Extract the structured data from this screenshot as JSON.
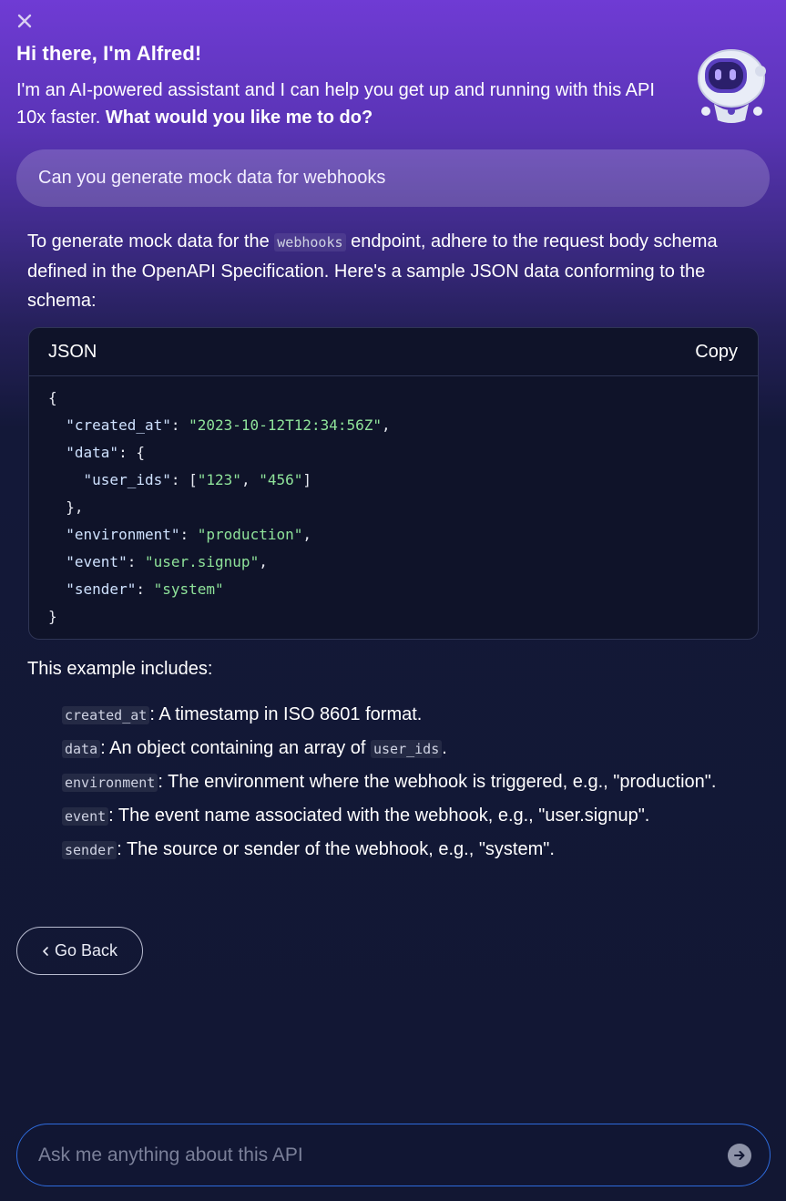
{
  "header": {
    "title": "Hi there, I'm Alfred!",
    "intro_plain": "I'm an AI-powered assistant and I can help you get up and running with this API 10x faster. ",
    "intro_bold": "What would you like me to do?"
  },
  "user_message": "Can you generate mock data for webhooks",
  "answer": {
    "intro_prefix": "To generate mock data for the ",
    "intro_code": "webhooks",
    "intro_suffix": " endpoint, adhere to the request body schema defined in the OpenAPI Specification. Here's a sample JSON data conforming to the schema:",
    "code_block": {
      "language": "JSON",
      "copy_label": "Copy",
      "lines": {
        "open": "{",
        "created_at_key": "\"created_at\"",
        "created_at_val": "\"2023-10-12T12:34:56Z\"",
        "data_key": "\"data\"",
        "user_ids_key": "\"user_ids\"",
        "user_id_1": "\"123\"",
        "user_id_2": "\"456\"",
        "environment_key": "\"environment\"",
        "environment_val": "\"production\"",
        "event_key": "\"event\"",
        "event_val": "\"user.signup\"",
        "sender_key": "\"sender\"",
        "sender_val": "\"system\"",
        "close": "}"
      }
    },
    "includes_title": "This example includes:",
    "includes": [
      {
        "code": "created_at",
        "text": ": A timestamp in ISO 8601 format."
      },
      {
        "code": "data",
        "text": ": An object containing an array of ",
        "code2": "user_ids",
        "text2": "."
      },
      {
        "code": "environment",
        "text": ": The environment where the webhook is triggered, e.g., \"production\"."
      },
      {
        "code": "event",
        "text": ": The event name associated with the webhook, e.g., \"user.signup\"."
      },
      {
        "code": "sender",
        "text": ": The source or sender of the webhook, e.g., \"system\"."
      }
    ]
  },
  "back_button": "Go Back",
  "chat_input": {
    "placeholder": "Ask me anything about this API",
    "value": ""
  },
  "icons": {
    "close": "close-icon",
    "back": "chevron-left-icon",
    "send": "arrow-right-icon",
    "avatar": "robot-avatar-icon"
  },
  "colors": {
    "accent_border": "#2e6bdc",
    "json_string": "#8fe39a",
    "background_top": "#6f3bd4",
    "background_bottom": "#121733"
  }
}
